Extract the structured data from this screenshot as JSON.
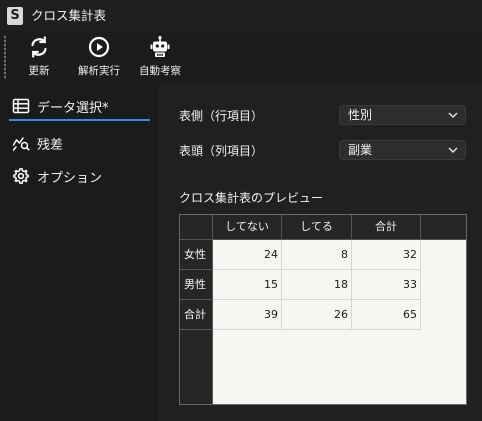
{
  "window": {
    "title": "クロス集計表",
    "app_icon_letter": "S"
  },
  "toolbar": {
    "buttons": [
      {
        "label": "更新",
        "icon": "refresh-icon"
      },
      {
        "label": "解析実行",
        "icon": "play-circle-icon"
      },
      {
        "label": "自動考察",
        "icon": "robot-icon"
      }
    ]
  },
  "sidebar": {
    "items": [
      {
        "label": "データ選択*",
        "icon": "table-icon",
        "selected": true
      },
      {
        "label": "残差",
        "icon": "chart-search-icon",
        "selected": false
      },
      {
        "label": "オプション",
        "icon": "gear-icon",
        "selected": false
      }
    ],
    "accent_color": "#2e8ff0"
  },
  "form": {
    "row_field": {
      "label": "表側（行項目）",
      "value": "性別"
    },
    "col_field": {
      "label": "表頭（列項目）",
      "value": "副業"
    }
  },
  "preview": {
    "title": "クロス集計表のプレビュー",
    "columns": [
      "してない",
      "してる",
      "合計"
    ],
    "rows": [
      {
        "label": "女性",
        "cells": [
          "24",
          "8",
          "32"
        ]
      },
      {
        "label": "男性",
        "cells": [
          "15",
          "18",
          "33"
        ]
      },
      {
        "label": "合計",
        "cells": [
          "39",
          "26",
          "65"
        ]
      }
    ]
  }
}
